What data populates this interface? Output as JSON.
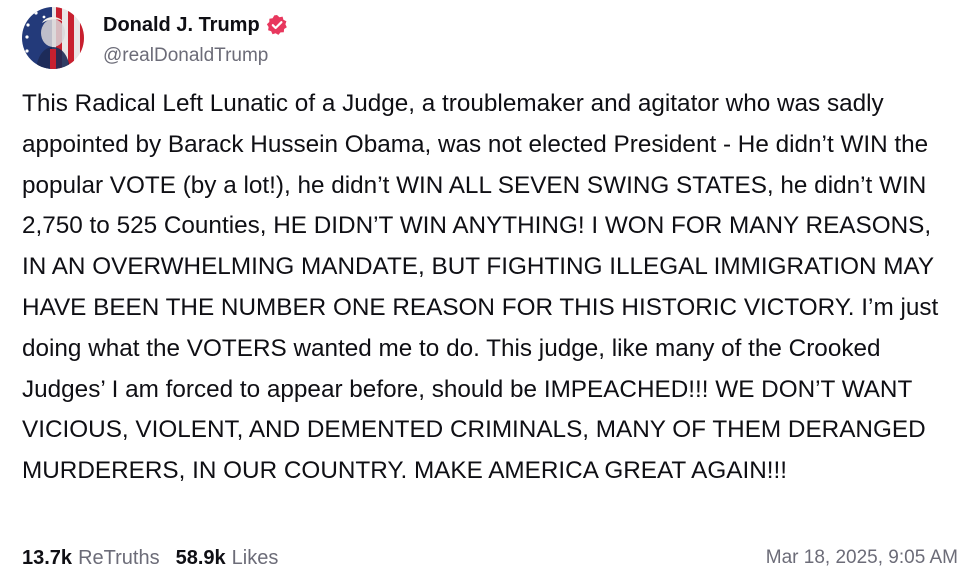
{
  "post": {
    "author": {
      "name": "Donald J. Trump",
      "handle": "@realDonaldTrump",
      "verified": true,
      "verified_color": "#e8385e"
    },
    "text": "This Radical Left Lunatic of a Judge, a troublemaker and agitator who was sadly appointed by Barack Hussein Obama, was not elected President - He didn’t WIN the popular VOTE (by a lot!), he didn’t WIN ALL SEVEN SWING STATES, he didn’t WIN 2,750 to 525 Counties, HE DIDN’T WIN ANYTHING! I WON FOR MANY REASONS, IN AN OVERWHELMING MANDATE, BUT FIGHTING ILLEGAL IMMIGRATION MAY HAVE BEEN THE NUMBER ONE REASON FOR THIS HISTORIC VICTORY. I’m just doing what the VOTERS wanted me to do. This judge, like many of the Crooked Judges’ I am forced to appear before, should be IMPEACHED!!! WE DON’T WANT VICIOUS, VIOLENT, AND DEMENTED CRIMINALS, MANY OF THEM DERANGED MURDERERS, IN OUR COUNTRY. MAKE AMERICA GREAT AGAIN!!!",
    "stats": {
      "retruths_count": "13.7k",
      "retruths_label": "ReTruths",
      "likes_count": "58.9k",
      "likes_label": "Likes"
    },
    "timestamp": "Mar 18, 2025, 9:05 AM"
  },
  "icons": {
    "avatar": "avatar-flag-portrait",
    "verified": "verified-badge-icon"
  }
}
